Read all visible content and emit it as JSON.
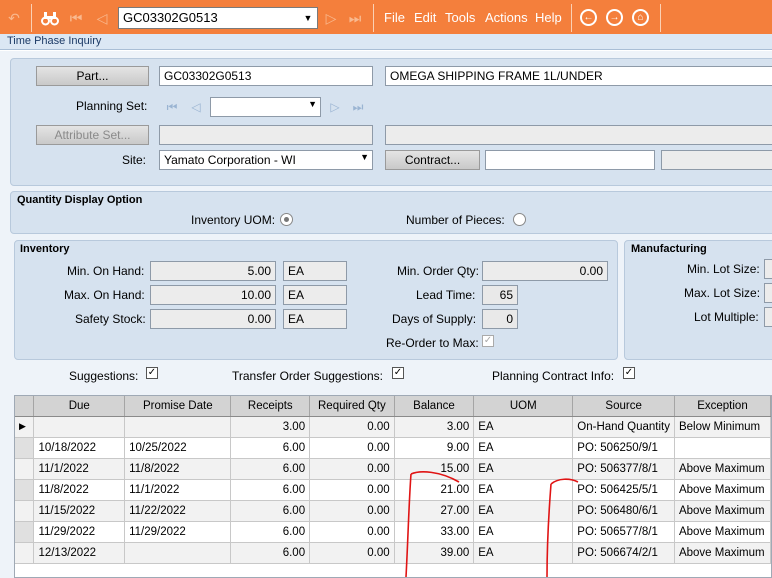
{
  "toolbar": {
    "part_value": "GC03302G0513",
    "menus": [
      "File",
      "Edit",
      "Tools",
      "Actions",
      "Help"
    ]
  },
  "window_title": "Time Phase Inquiry",
  "header": {
    "part_button": "Part...",
    "part_value": "GC03302G0513",
    "part_description": "OMEGA SHIPPING FRAME 1L/UNDER",
    "planning_set_label": "Planning Set:",
    "attribute_set_button": "Attribute Set...",
    "site_label": "Site:",
    "site_value": "Yamato Corporation - WI",
    "contract_button": "Contract..."
  },
  "quantity_display": {
    "title": "Quantity Display Option",
    "inventory_uom_label": "Inventory UOM:",
    "number_of_pieces_label": "Number of Pieces:"
  },
  "inventory": {
    "title": "Inventory",
    "min_on_hand_label": "Min. On Hand:",
    "min_on_hand": "5.00",
    "max_on_hand_label": "Max. On Hand:",
    "max_on_hand": "10.00",
    "safety_stock_label": "Safety Stock:",
    "safety_stock": "0.00",
    "uom": "EA",
    "min_order_qty_label": "Min. Order Qty:",
    "min_order_qty": "0.00",
    "lead_time_label": "Lead Time:",
    "lead_time": "65",
    "days_of_supply_label": "Days of Supply:",
    "days_of_supply": "0",
    "reorder_label": "Re-Order to Max:"
  },
  "manufacturing": {
    "title": "Manufacturing",
    "min_lot_size_label": "Min. Lot Size:",
    "max_lot_size_label": "Max. Lot Size:",
    "lot_multiple_label": "Lot Multiple:"
  },
  "options": {
    "suggestions_label": "Suggestions:",
    "transfer_label": "Transfer Order Suggestions:",
    "planning_contract_label": "Planning Contract Info:"
  },
  "grid": {
    "columns": [
      "Due",
      "Promise Date",
      "Receipts",
      "Required Qty",
      "Balance",
      "UOM",
      "Source",
      "Exception"
    ],
    "rows": [
      {
        "due": "",
        "promise": "",
        "receipts": "3.00",
        "required": "0.00",
        "balance": "3.00",
        "uom": "EA",
        "source": "On-Hand Quantity",
        "exception": "Below Minimum"
      },
      {
        "due": "10/18/2022",
        "promise": "10/25/2022",
        "receipts": "6.00",
        "required": "0.00",
        "balance": "9.00",
        "uom": "EA",
        "source": "PO: 506250/9/1",
        "exception": ""
      },
      {
        "due": "11/1/2022",
        "promise": "11/8/2022",
        "receipts": "6.00",
        "required": "0.00",
        "balance": "15.00",
        "uom": "EA",
        "source": "PO: 506377/8/1",
        "exception": "Above Maximum"
      },
      {
        "due": "11/8/2022",
        "promise": "11/1/2022",
        "receipts": "6.00",
        "required": "0.00",
        "balance": "21.00",
        "uom": "EA",
        "source": "PO: 506425/5/1",
        "exception": "Above Maximum"
      },
      {
        "due": "11/15/2022",
        "promise": "11/22/2022",
        "receipts": "6.00",
        "required": "0.00",
        "balance": "27.00",
        "uom": "EA",
        "source": "PO: 506480/6/1",
        "exception": "Above Maximum"
      },
      {
        "due": "11/29/2022",
        "promise": "11/29/2022",
        "receipts": "6.00",
        "required": "0.00",
        "balance": "33.00",
        "uom": "EA",
        "source": "PO: 506577/8/1",
        "exception": "Above Maximum"
      },
      {
        "due": "12/13/2022",
        "promise": "",
        "receipts": "6.00",
        "required": "0.00",
        "balance": "39.00",
        "uom": "EA",
        "source": "PO: 506674/2/1",
        "exception": "Above Maximum"
      }
    ]
  },
  "colors": {
    "toolbar": "#f47f3c",
    "annotation": "#e01414"
  }
}
